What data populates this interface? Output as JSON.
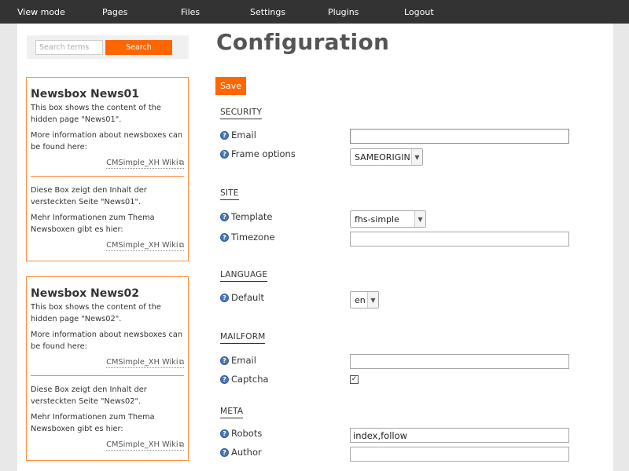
{
  "nav": {
    "items": [
      {
        "label": "View mode"
      },
      {
        "label": "Pages"
      },
      {
        "label": "Files"
      },
      {
        "label": "Settings"
      },
      {
        "label": "Plugins"
      },
      {
        "label": "Logout"
      }
    ]
  },
  "search": {
    "placeholder": "Search terms",
    "button_label": "Search"
  },
  "newsboxes": [
    {
      "title": "Newsbox News01",
      "en_text": "This box shows the content of the hidden page \"News01\".",
      "en_more": "More information about newsboxes can be found here:",
      "link_label": "CMSimple_XH Wiki",
      "de_text": "Diese Box zeigt den Inhalt der versteckten Seite \"News01\".",
      "de_more": "Mehr Informationen zum Thema Newsboxen gibt es hier:"
    },
    {
      "title": "Newsbox News02",
      "en_text": "This box shows the content of the hidden page \"News02\".",
      "en_more": "More information about newsboxes can be found here:",
      "link_label": "CMSimple_XH Wiki",
      "de_text": "Diese Box zeigt den Inhalt der versteckten Seite \"News02\".",
      "de_more": "Mehr Informationen zum Thema Newsboxen gibt es hier:"
    }
  ],
  "config": {
    "title": "Configuration",
    "save_label": "Save",
    "sections": {
      "security": {
        "heading": "SECURITY",
        "email_label": "Email",
        "email_value": "",
        "frame_label": "Frame options",
        "frame_value": "SAMEORIGIN"
      },
      "site": {
        "heading": "SITE",
        "template_label": "Template",
        "template_value": "fhs-simple",
        "timezone_label": "Timezone",
        "timezone_value": ""
      },
      "language": {
        "heading": "LANGUAGE",
        "default_label": "Default",
        "default_value": "en"
      },
      "mailform": {
        "heading": "MAILFORM",
        "email_label": "Email",
        "email_value": "",
        "captcha_label": "Captcha",
        "captcha_checked": true
      },
      "meta": {
        "heading": "META",
        "robots_label": "Robots",
        "robots_value": "index,follow",
        "author_label": "Author",
        "author_value": ""
      }
    }
  },
  "icons": {
    "help": "help-icon",
    "external_link": "external-link-icon",
    "dropdown": "chevron-down-icon"
  },
  "colors": {
    "accent": "#ff6600",
    "adminbar": "#333333",
    "help_icon": "#4a78b8"
  }
}
